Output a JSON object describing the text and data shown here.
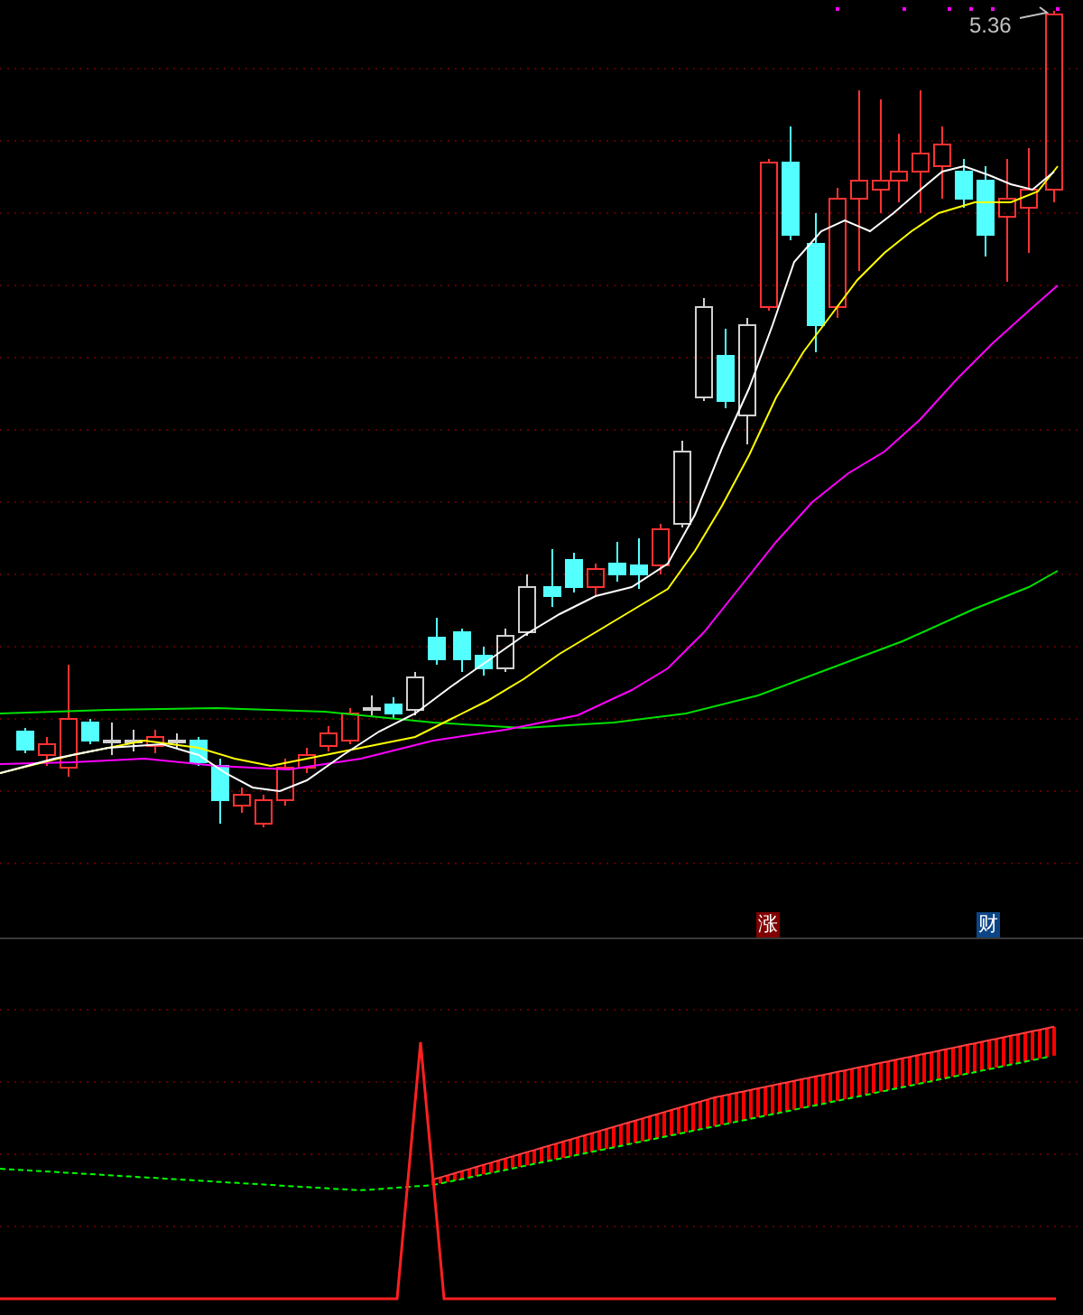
{
  "price_panel": {
    "latest_price": "5.36",
    "signals": [
      {
        "label": "涨",
        "color": "#800000"
      },
      {
        "label": "财",
        "color": "#0c4585"
      }
    ]
  }
}
